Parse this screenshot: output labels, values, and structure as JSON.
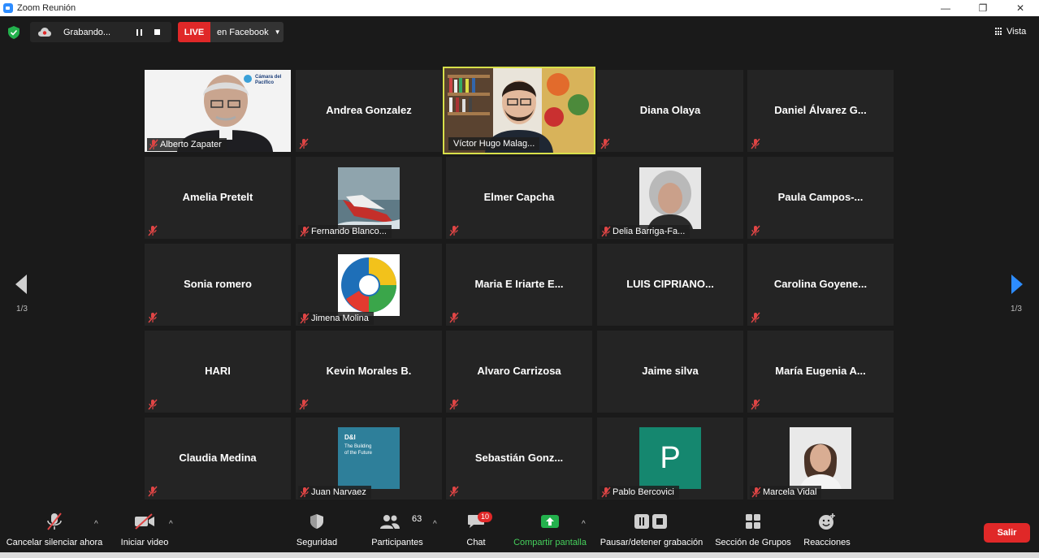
{
  "window": {
    "title": "Zoom Reunión",
    "minimize": "—",
    "restore": "❐",
    "close": "✕"
  },
  "top": {
    "recording_label": "Grabando...",
    "live_label": "LIVE",
    "live_destination": "en Facebook",
    "live_caret": "▼",
    "view_label": "Vista",
    "page_left": "1/3",
    "page_right": "1/3"
  },
  "tiles": [
    {
      "name": "Alberto Zapater",
      "kind": "video"
    },
    {
      "name": "Andrea Gonzalez",
      "kind": "name"
    },
    {
      "name": "Víctor Hugo Malag...",
      "kind": "video",
      "active": true
    },
    {
      "name": "Diana Olaya",
      "kind": "name"
    },
    {
      "name": "Daniel  Álvarez  G...",
      "kind": "name"
    },
    {
      "name": "Amelia Pretelt",
      "kind": "name"
    },
    {
      "name": "Fernando Blanco...",
      "kind": "thumb"
    },
    {
      "name": "Elmer Capcha",
      "kind": "name"
    },
    {
      "name": "Delia Barriga-Fa...",
      "kind": "thumb"
    },
    {
      "name": "Paula  Campos-...",
      "kind": "name"
    },
    {
      "name": "Sonia romero",
      "kind": "name"
    },
    {
      "name": "Jimena Molina",
      "kind": "thumb"
    },
    {
      "name": "Maria E Iriarte E...",
      "kind": "name"
    },
    {
      "name": "LUIS CIPRIANO...",
      "kind": "name"
    },
    {
      "name": "Carolina  Goyene...",
      "kind": "name"
    },
    {
      "name": "HARI",
      "kind": "name"
    },
    {
      "name": "Kevin Morales B.",
      "kind": "name"
    },
    {
      "name": "Alvaro Carrizosa",
      "kind": "name"
    },
    {
      "name": "Jaime silva",
      "kind": "name"
    },
    {
      "name": "María  Eugenia  A...",
      "kind": "name"
    },
    {
      "name": "Claudia Medina",
      "kind": "name"
    },
    {
      "name": "Juan Narvaez",
      "kind": "thumb"
    },
    {
      "name": "Sebastián  Gonz...",
      "kind": "name"
    },
    {
      "name": "Pablo Bercovici",
      "kind": "thumb"
    },
    {
      "name": "Marcela Vidal",
      "kind": "thumb"
    }
  ],
  "thumb_text": {
    "camara_logo": "Cámara del Pacífico",
    "di_title": "D&I",
    "di_sub": "The Building of the Future",
    "pablo_initial": "P"
  },
  "toolbar": {
    "mute": "Cancelar silenciar ahora",
    "video": "Iniciar video",
    "security": "Seguridad",
    "participants": "Participantes",
    "participants_count": "63",
    "chat": "Chat",
    "chat_badge": "10",
    "share": "Compartir pantalla",
    "record": "Pausar/detener grabación",
    "breakout": "Sección de Grupos",
    "reactions": "Reacciones",
    "leave": "Salir",
    "caret": "^"
  },
  "colors": {
    "accent_green": "#45d05c",
    "live_red": "#e02828",
    "active_border": "#d8e04a",
    "tile_bg": "#242424"
  }
}
